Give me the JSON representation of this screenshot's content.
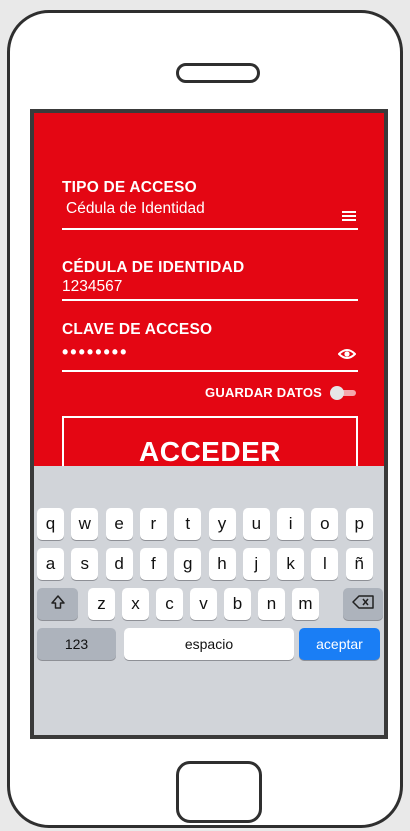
{
  "form": {
    "access_type_label": "TIPO DE ACCESO",
    "access_type_value": "Cédula de Identidad",
    "id_label": "CÉDULA DE IDENTIDAD",
    "id_value": "1234567",
    "password_label": "CLAVE DE ACCESO",
    "password_value": "••••••••",
    "save_data_label": "GUARDAR DATOS",
    "save_data_enabled": false,
    "submit_label": "ACCEDER"
  },
  "keyboard": {
    "row1": [
      "q",
      "w",
      "e",
      "r",
      "t",
      "y",
      "u",
      "i",
      "o",
      "p"
    ],
    "row2": [
      "a",
      "s",
      "d",
      "f",
      "g",
      "h",
      "j",
      "k",
      "l",
      "ñ"
    ],
    "row3": [
      "z",
      "x",
      "c",
      "v",
      "b",
      "n",
      "m"
    ],
    "numbers_key": "123",
    "space_key": "espacio",
    "accept_key": "aceptar"
  },
  "colors": {
    "brand_red": "#e40613",
    "accept_blue": "#1a7ef5"
  },
  "icons": {
    "access_type": "list-icon",
    "password": "eye-icon",
    "shift": "shift-arrow-icon",
    "backspace": "backspace-icon"
  }
}
